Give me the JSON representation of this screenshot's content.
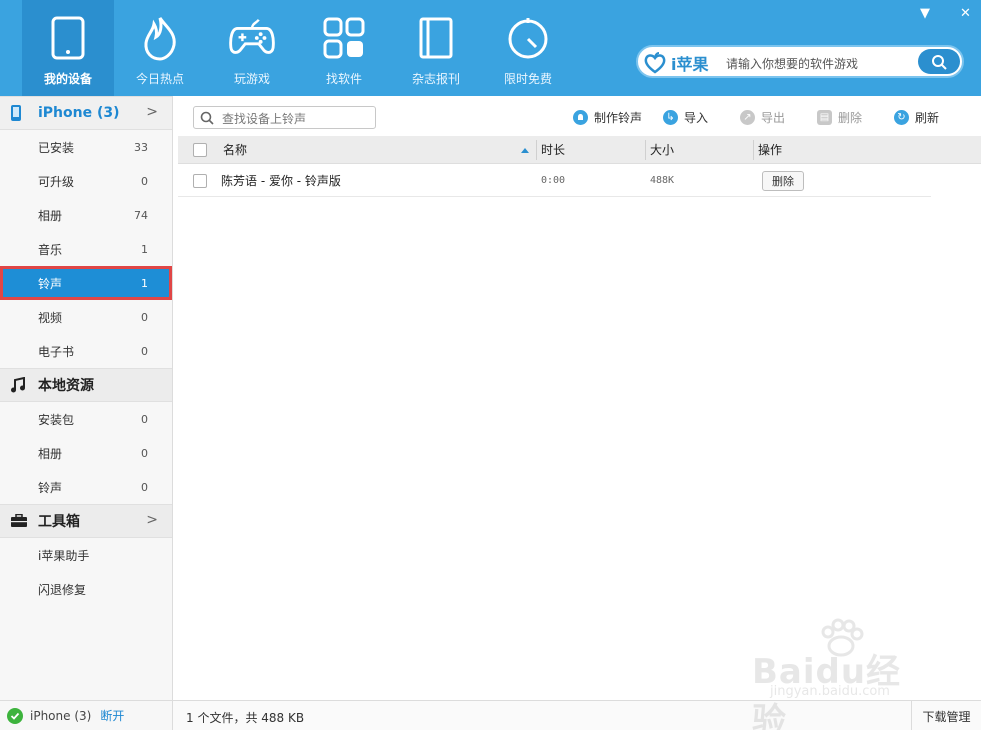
{
  "window": {
    "minimize": "▼",
    "close": "✕"
  },
  "nav": [
    {
      "label": "我的设备",
      "icon": "tablet-icon",
      "active": true
    },
    {
      "label": "今日热点",
      "icon": "flame-icon"
    },
    {
      "label": "玩游戏",
      "icon": "gamepad-icon"
    },
    {
      "label": "找软件",
      "icon": "apps-grid-icon"
    },
    {
      "label": "杂志报刊",
      "icon": "book-icon"
    },
    {
      "label": "限时免费",
      "icon": "timer-icon"
    }
  ],
  "search": {
    "brand": "i苹果",
    "placeholder": "请输入你想要的软件游戏"
  },
  "sidebar": {
    "device": {
      "title": "iPhone (3)"
    },
    "device_items": [
      {
        "label": "已安装",
        "count": "33"
      },
      {
        "label": "可升级",
        "count": "0"
      },
      {
        "label": "相册",
        "count": "74"
      },
      {
        "label": "音乐",
        "count": "1"
      },
      {
        "label": "铃声",
        "count": "1"
      },
      {
        "label": "视频",
        "count": "0"
      },
      {
        "label": "电子书",
        "count": "0"
      }
    ],
    "local": {
      "title": "本地资源"
    },
    "local_items": [
      {
        "label": "安装包",
        "count": "0"
      },
      {
        "label": "相册",
        "count": "0"
      },
      {
        "label": "铃声",
        "count": "0"
      }
    ],
    "tools": {
      "title": "工具箱"
    },
    "tool_items": [
      {
        "label": "i苹果助手"
      },
      {
        "label": "闪退修复"
      }
    ],
    "footer": {
      "device": "iPhone (3)",
      "disconnect": "断开"
    }
  },
  "toolbar": {
    "search_placeholder": "查找设备上铃声",
    "make_ringtone": "制作铃声",
    "import": "导入",
    "export": "导出",
    "delete": "删除",
    "refresh": "刷新"
  },
  "table": {
    "columns": [
      "名称",
      "时长",
      "大小",
      "操作"
    ],
    "rows": [
      {
        "name": "陈芳语 - 爱你 - 铃声版",
        "duration": "0:00",
        "size": "488K",
        "action": "删除"
      }
    ]
  },
  "status": {
    "text": "1 个文件，共 488 KB",
    "download_manager": "下载管理"
  },
  "watermark": {
    "text": "Baidu经验",
    "sub": "jingyan.baidu.com"
  },
  "colors": {
    "accent": "#3aa3e0",
    "selected": "#1e8ed6",
    "highlight_border": "#e04646"
  }
}
